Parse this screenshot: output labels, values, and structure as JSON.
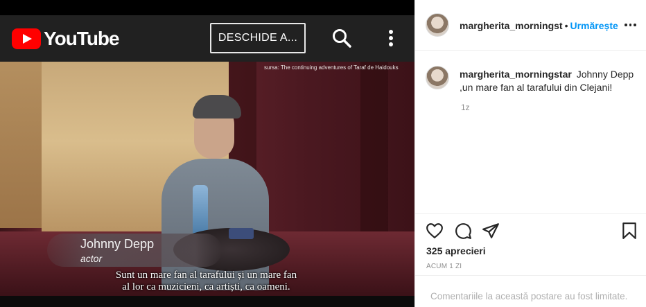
{
  "youtube": {
    "logo_text": "YouTube",
    "open_button": "DESCHIDE A...",
    "icons": {
      "search": "search-icon",
      "more": "more-vertical-icon",
      "logo": "youtube-play-icon"
    }
  },
  "video": {
    "source_note": "sursa: The continuing adventures of Taraf de Haidouks",
    "lower_third": {
      "name": "Johnny Depp",
      "role": "actor"
    },
    "subtitles": [
      "Sunt un mare fan al tarafului și un mare fan",
      "al lor ca muzicieni, ca artiști, ca oameni."
    ]
  },
  "instagram": {
    "header": {
      "username": "margherita_morningst",
      "separator": "•",
      "follow_label": "Urmărește",
      "more_icon": "more-horizontal-icon"
    },
    "caption": {
      "username": "margherita_morningstar",
      "text": "Johnny Depp ,un mare fan al tarafului din Clejani!",
      "relative_time": "1z"
    },
    "actions": {
      "icons": [
        "heart-icon",
        "comment-icon",
        "share-icon",
        "bookmark-icon"
      ]
    },
    "likes": "325 aprecieri",
    "posted": "ACUM 1 ZI",
    "comments_limited": "Comentariile la această postare au fost limitate."
  },
  "colors": {
    "follow_blue": "#0095f6",
    "youtube_red": "#ff0000",
    "yt_bar": "#212121",
    "text_primary": "#262626",
    "text_secondary": "#8e8e8e"
  }
}
